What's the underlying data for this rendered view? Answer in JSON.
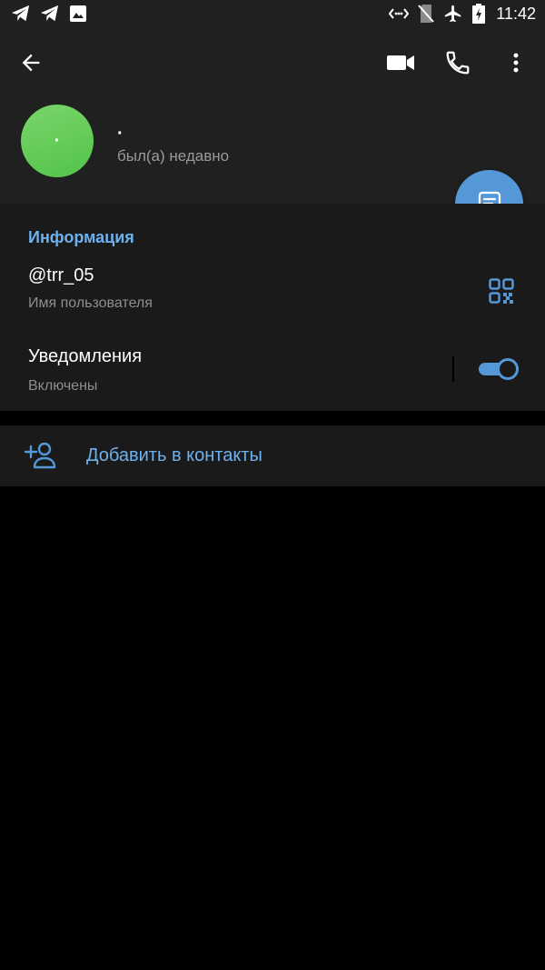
{
  "status_bar": {
    "time": "11:42",
    "left_icons": [
      "telegram-icon",
      "telegram-icon",
      "image-icon"
    ],
    "right_icons": [
      "data-saver-icon",
      "no-sim-icon",
      "airplane-icon",
      "battery-charging-icon"
    ]
  },
  "header": {
    "back_icon": "arrow-left-icon",
    "actions": [
      "video-call-icon",
      "phone-icon",
      "more-vert-icon"
    ],
    "avatar_text": "·",
    "name": "·",
    "status": "был(а) недавно",
    "fab_icon": "message-icon"
  },
  "info": {
    "title": "Информация",
    "username": "@trr_05",
    "username_label": "Имя пользователя",
    "notifications_label": "Уведомления",
    "notifications_value": "Включены",
    "notifications_enabled": true,
    "qr_icon": "qr-code-icon"
  },
  "add_contact": {
    "label": "Добавить в контакты",
    "icon": "add-person-icon"
  },
  "colors": {
    "accent": "#5598d8",
    "accent_text": "#6cb2f0",
    "header_bg": "#202020",
    "section_bg": "#1a1a1a",
    "avatar": "#62c956"
  }
}
